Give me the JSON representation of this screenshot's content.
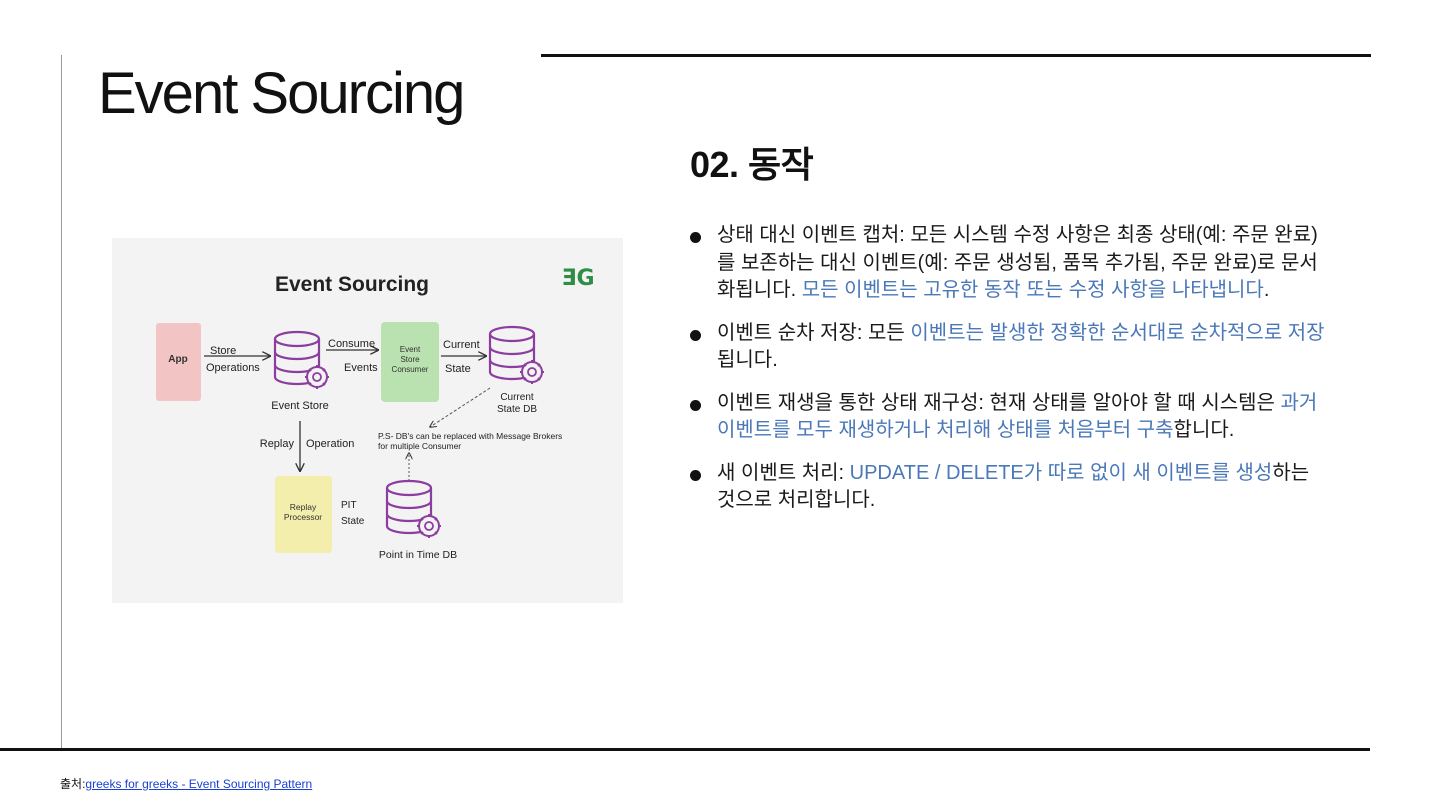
{
  "slide": {
    "title": "Event Sourcing",
    "subtitle": "02. 동작",
    "bullets": [
      {
        "segments": [
          {
            "text": "상태 대신 이벤트 캡처: 모든 시스템 수정 사항은 최종 상태(예: 주문 완료)를 보존하는 대신 이벤트(예: 주문 생성됨, 품목 추가됨, 주문 완료)로 문서화됩니다. ",
            "highlight": false
          },
          {
            "text": "모든 이벤트는 고유한 동작 또는 수정 사항을 나타냅니다",
            "highlight": true
          },
          {
            "text": ".",
            "highlight": false
          }
        ]
      },
      {
        "segments": [
          {
            "text": "이벤트 순차 저장: 모든 ",
            "highlight": false
          },
          {
            "text": "이벤트는 발생한 정확한 순서대로 순차적으로 저장",
            "highlight": true
          },
          {
            "text": "됩니다.",
            "highlight": false
          }
        ]
      },
      {
        "segments": [
          {
            "text": "이벤트 재생을 통한 상태 재구성: 현재 상태를 알아야 할 때 시스템은 ",
            "highlight": false
          },
          {
            "text": "과거 이벤트를 모두 재생하거나 처리해 상태를 처음부터 구축",
            "highlight": true
          },
          {
            "text": "합니다.",
            "highlight": false
          }
        ]
      },
      {
        "segments": [
          {
            "text": "새 이벤트 처리: ",
            "highlight": false
          },
          {
            "text": "UPDATE / DELETE가 따로 없이 새 이벤트를 생성",
            "highlight": true
          },
          {
            "text": "하는 것으로 처리합니다.",
            "highlight": false
          }
        ]
      }
    ],
    "footer": {
      "prefix": "출처:",
      "link_text": "greeks for greeks - Event Sourcing Pattern"
    }
  },
  "diagram": {
    "title": "Event Sourcing",
    "logo_text": "ƎG",
    "app_label": "App",
    "store_label": "Store",
    "operations_label": "Operations",
    "event_store_label": "Event Store",
    "consume_label": "Consume",
    "events_label": "Events",
    "consumer_box": [
      "Event",
      "Store",
      "Consumer"
    ],
    "current_label": "Current",
    "state_label": "State",
    "current_state_db": [
      "Current",
      "State DB"
    ],
    "ps_note": [
      "P.S- DB's can be replaced with Message Brokers",
      "for multiple Consumer"
    ],
    "replay_label": "Replay",
    "operation_label": "Operation",
    "replay_box": [
      "Replay",
      "Processor"
    ],
    "pit_label": "PIT",
    "pit_state_label": "State",
    "point_in_time_db": "Point in Time DB",
    "colors": {
      "app_box": "#f2c4c4",
      "consumer_box": "#b9e2b0",
      "replay_box": "#f3eeab",
      "db_stroke": "#8b3e9e",
      "logo": "#2f8d46",
      "highlight": "#4a78b8"
    }
  }
}
